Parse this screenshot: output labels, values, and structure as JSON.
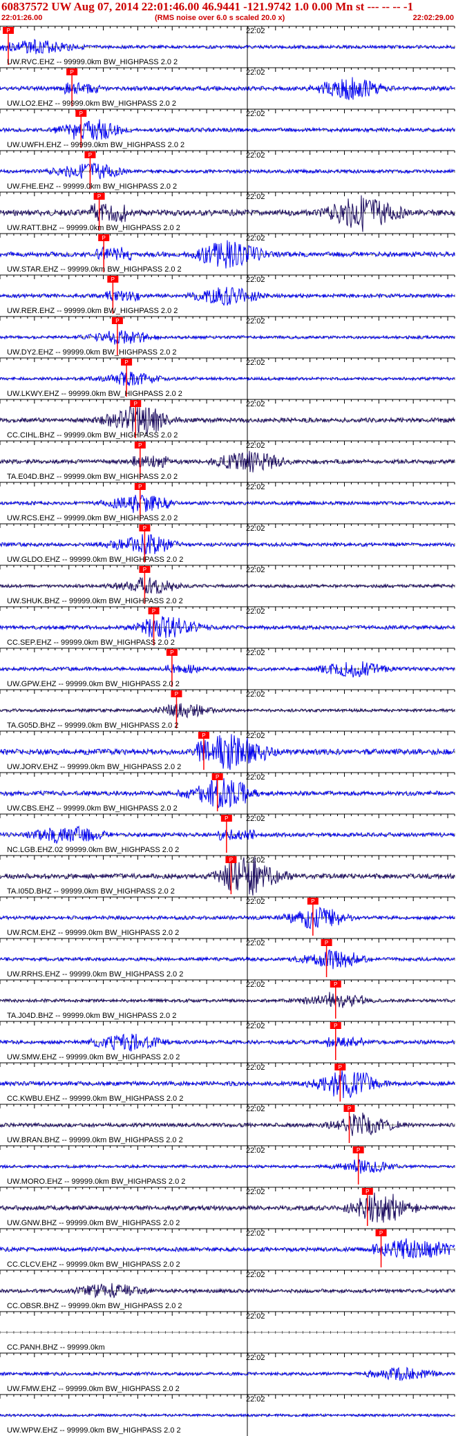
{
  "header": {
    "title": "60837572 UW Aug 07, 2014 22:01:46.00   46.9441 -121.9742  1.0 0.00 Mn st --- -- --  -1",
    "start_time": "22:01:26.00",
    "noise_note": "(RMS noise over 6.0 s scaled 20.0 x)",
    "end_time": "22:02:29.00"
  },
  "colors": {
    "header_red": "#cc0000",
    "trace_blue": "#0000ee",
    "trace_dark": "#1a0a5e",
    "pick_red": "#ff0000",
    "axis_black": "#000000"
  },
  "time_tick_label": "22:02",
  "traces": [
    {
      "label": "UW.RVC.EHZ -- 99999.0km BW_HIGHPASS  2.0  2",
      "pick": "P",
      "pick_time": 0.0,
      "color": "blue",
      "activity": 0.3,
      "burst_time": 0.1
    },
    {
      "label": "UW.LO2.EHZ -- 99999.0km BW_HIGHPASS  2.0  2",
      "pick": "P",
      "pick_time": 0.14,
      "color": "blue",
      "activity": 0.55,
      "burst_time": 0.77
    },
    {
      "label": "UW.UWFH.EHZ -- 99999.0km BW_HIGHPASS  2.0  2",
      "pick": "P",
      "pick_time": 0.16,
      "color": "blue",
      "activity": 0.45,
      "burst_time": 0.2
    },
    {
      "label": "UW.FHE.EHZ -- 99999.0km BW_HIGHPASS  2.0  2",
      "pick": "P",
      "pick_time": 0.18,
      "color": "blue",
      "activity": 0.35,
      "burst_time": 0.19
    },
    {
      "label": "UW.RATT.BHZ -- 99999.0km BW_HIGHPASS  2.0  2",
      "pick": "P",
      "pick_time": 0.2,
      "color": "dark",
      "activity": 0.95,
      "burst_time": 0.8
    },
    {
      "label": "UW.STAR.EHZ -- 99999.0km BW_HIGHPASS  2.0  2",
      "pick": "P",
      "pick_time": 0.21,
      "color": "blue",
      "activity": 0.7,
      "burst_time": 0.5
    },
    {
      "label": "UW.RER.EHZ -- 99999.0km BW_HIGHPASS  2.0  2",
      "pick": "P",
      "pick_time": 0.23,
      "color": "blue",
      "activity": 0.45,
      "burst_time": 0.5
    },
    {
      "label": "UW.DY2.EHZ -- 99999.0km BW_HIGHPASS  2.0  2",
      "pick": "P",
      "pick_time": 0.24,
      "color": "blue",
      "activity": 0.25,
      "burst_time": 0.26
    },
    {
      "label": "UW.LKWY.EHZ -- 99999.0km BW_HIGHPASS  2.0  2",
      "pick": "P",
      "pick_time": 0.26,
      "color": "blue",
      "activity": 0.25,
      "burst_time": 0.28
    },
    {
      "label": "CC.CIHL.BHZ -- 99999.0km BW_HIGHPASS  2.0  2",
      "pick": "P",
      "pick_time": 0.28,
      "color": "dark",
      "activity": 0.6,
      "burst_time": 0.3
    },
    {
      "label": "TA.E04D.BHZ -- 99999.0km BW_HIGHPASS  2.0  2",
      "pick": "P",
      "pick_time": 0.29,
      "color": "dark",
      "activity": 0.55,
      "burst_time": 0.55
    },
    {
      "label": "UW.RCS.EHZ -- 99999.0km BW_HIGHPASS  2.0  2",
      "pick": "P",
      "pick_time": 0.29,
      "color": "blue",
      "activity": 0.35,
      "burst_time": 0.3
    },
    {
      "label": "UW.GLDO.EHZ -- 99999.0km BW_HIGHPASS  2.0  2",
      "pick": "P",
      "pick_time": 0.3,
      "color": "blue",
      "activity": 0.4,
      "burst_time": 0.31
    },
    {
      "label": "UW.SHUK.BHZ -- 99999.0km BW_HIGHPASS  2.0  2",
      "pick": "P",
      "pick_time": 0.3,
      "color": "dark",
      "activity": 0.3,
      "burst_time": 0.32
    },
    {
      "label": "CC.SEP.EHZ -- 99999.0km BW_HIGHPASS  2.0  2",
      "pick": "P",
      "pick_time": 0.32,
      "color": "blue",
      "activity": 0.45,
      "burst_time": 0.37
    },
    {
      "label": "UW.GPW.EHZ -- 99999.0km BW_HIGHPASS  2.0  2",
      "pick": "P",
      "pick_time": 0.36,
      "color": "blue",
      "activity": 0.4,
      "burst_time": 0.78
    },
    {
      "label": "TA.G05D.BHZ -- 99999.0km BW_HIGHPASS  2.0  2",
      "pick": "P",
      "pick_time": 0.37,
      "color": "dark",
      "activity": 0.25,
      "burst_time": 0.4
    },
    {
      "label": "UW.JORV.EHZ -- 99999.0km BW_HIGHPASS  2.0  2",
      "pick": "P",
      "pick_time": 0.43,
      "color": "blue",
      "activity": 0.85,
      "burst_time": 0.52
    },
    {
      "label": "UW.CBS.EHZ -- 99999.0km BW_HIGHPASS  2.0  2",
      "pick": "P",
      "pick_time": 0.46,
      "color": "blue",
      "activity": 0.6,
      "burst_time": 0.48
    },
    {
      "label": "NC.LGB.EHZ.02 99999.0km BW_HIGHPASS  2.0  2",
      "pick": "P",
      "pick_time": 0.48,
      "color": "blue",
      "activity": 0.5,
      "burst_time": 0.15
    },
    {
      "label": "TA.I05D.BHZ -- 99999.0km BW_HIGHPASS  2.0  2",
      "pick": "P",
      "pick_time": 0.49,
      "color": "dark",
      "activity": 0.75,
      "burst_time": 0.55
    },
    {
      "label": "UW.RCM.EHZ -- 99999.0km BW_HIGHPASS  2.0  2",
      "pick": "P",
      "pick_time": 0.67,
      "color": "blue",
      "activity": 0.4,
      "burst_time": 0.69
    },
    {
      "label": "UW.RRHS.EHZ -- 99999.0km BW_HIGHPASS  2.0  2",
      "pick": "P",
      "pick_time": 0.7,
      "color": "blue",
      "activity": 0.35,
      "burst_time": 0.73
    },
    {
      "label": "TA.J04D.BHZ -- 99999.0km BW_HIGHPASS  2.0  2",
      "pick": "P",
      "pick_time": 0.72,
      "color": "dark",
      "activity": 0.3,
      "burst_time": 0.73
    },
    {
      "label": "UW.SMW.EHZ -- 99999.0km BW_HIGHPASS  2.0  2",
      "pick": "P",
      "pick_time": 0.72,
      "color": "blue",
      "activity": 0.45,
      "burst_time": 0.28
    },
    {
      "label": "CC.KWBU.EHZ -- 99999.0km BW_HIGHPASS  2.0  2",
      "pick": "P",
      "pick_time": 0.73,
      "color": "blue",
      "activity": 0.55,
      "burst_time": 0.76
    },
    {
      "label": "UW.BRAN.BHZ -- 99999.0km BW_HIGHPASS  2.0  2",
      "pick": "P",
      "pick_time": 0.75,
      "color": "dark",
      "activity": 0.45,
      "burst_time": 0.8
    },
    {
      "label": "UW.MORO.EHZ -- 99999.0km BW_HIGHPASS  2.0  2",
      "pick": "P",
      "pick_time": 0.77,
      "color": "blue",
      "activity": 0.25,
      "burst_time": 0.8
    },
    {
      "label": "UW.GNW.BHZ -- 99999.0km BW_HIGHPASS  2.0  2",
      "pick": "P",
      "pick_time": 0.79,
      "color": "dark",
      "activity": 0.6,
      "burst_time": 0.84
    },
    {
      "label": "CC.CLCV.EHZ -- 99999.0km BW_HIGHPASS  2.0  2",
      "pick": "P",
      "pick_time": 0.82,
      "color": "blue",
      "activity": 0.5,
      "burst_time": 0.93
    },
    {
      "label": "CC.OBSR.BHZ -- 99999.0km BW_HIGHPASS  2.0  2",
      "pick": "",
      "pick_time": null,
      "color": "dark",
      "activity": 0.4,
      "burst_time": 0.24
    },
    {
      "label": "CC.PANH.BHZ -- 99999.0km",
      "pick": "",
      "pick_time": null,
      "color": "none",
      "activity": 0.0,
      "burst_time": null
    },
    {
      "label": "UW.FMW.EHZ -- 99999.0km BW_HIGHPASS  2.0  2",
      "pick": "",
      "pick_time": null,
      "color": "blue",
      "activity": 0.3,
      "burst_time": 0.88
    },
    {
      "label": "UW.WPW.EHZ -- 99999.0km BW_HIGHPASS  2.0  2",
      "pick": "",
      "pick_time": null,
      "color": "blue",
      "activity": 0.15,
      "burst_time": null
    }
  ]
}
